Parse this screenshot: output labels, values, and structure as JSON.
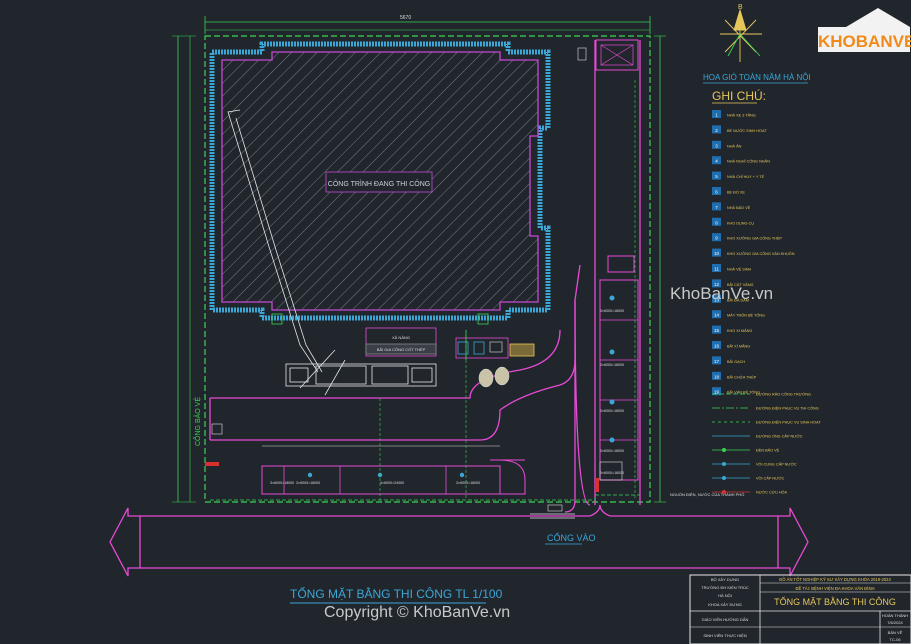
{
  "logo": {
    "text": "KHOBANVE"
  },
  "watermarks": {
    "main": "KhoBanVe.vn",
    "copyright": "Copyright © KhoBanVe.vn"
  },
  "compass": {
    "north": "B"
  },
  "legend": {
    "wind_title": "HOA GIÓ TOÀN NĂM HÀ NỘI",
    "title": "GHI CHÚ:",
    "numbered": [
      {
        "n": "1",
        "label": "NHÀ XE 3 TẦNG"
      },
      {
        "n": "2",
        "label": "BỂ NƯỚC SINH HOẠT"
      },
      {
        "n": "3",
        "label": "NHÀ ĂN"
      },
      {
        "n": "4",
        "label": "NHÀ NGHỈ CÔNG NHÂN"
      },
      {
        "n": "5",
        "label": "NHÀ CHỈ HUY + Y TẾ"
      },
      {
        "n": "6",
        "label": "BỂ ĐỔ XE"
      },
      {
        "n": "7",
        "label": "NHÀ BẢO VỆ"
      },
      {
        "n": "8",
        "label": "KHO DỤNG CỤ"
      },
      {
        "n": "9",
        "label": "KHO XƯỞNG GIA CÔNG THÉP"
      },
      {
        "n": "10",
        "label": "KHO XƯỞNG GIA CÔNG VÁN KHUÔN"
      },
      {
        "n": "11",
        "label": "NHÀ VỆ SINH"
      },
      {
        "n": "12",
        "label": "BÃI CÁT VÀNG"
      },
      {
        "n": "13",
        "label": "BÃI ĐÁ DĂM"
      },
      {
        "n": "14",
        "label": "MÁY TRỘN BÊ TÔNG"
      },
      {
        "n": "15",
        "label": "KHO XI MĂNG"
      },
      {
        "n": "16",
        "label": "BÃI XÍ MĂNG"
      },
      {
        "n": "17",
        "label": "BÃI GẠCH"
      },
      {
        "n": "18",
        "label": "BÃI CHỨA THÉP"
      },
      {
        "n": "19",
        "label": "BÃI VÁN BÊ TÔNG"
      }
    ],
    "symbols": [
      {
        "label": "ĐƯỜNG RÀO CÔNG TRƯỜNG"
      },
      {
        "label": "ĐƯỜNG ĐIỆN PHỤC VỤ THI CÔNG"
      },
      {
        "label": "ĐƯỜNG ĐIỆN PHỤC VỤ SINH HOẠT"
      },
      {
        "label": "ĐƯỜNG ỐNG CẤP NƯỚC"
      },
      {
        "label": "ĐÈN BẢO VỆ"
      },
      {
        "label": "VÒI CUNG CẤP NƯỚC"
      },
      {
        "label": "VÒI CẤP NƯỚC"
      },
      {
        "label": "NƯỚC CỨU HỎA"
      }
    ]
  },
  "site": {
    "building_label": "CÔNG TRÌNH ĐANG THI CÔNG",
    "gate_label": "CỔNG VÀO",
    "side_gate_label": "CỔNG BẢO VỆ",
    "supply_label": "NGUỒN ĐIỆN, NƯỚC CỦA THÀNH PHỐ",
    "crane_label1": "XÂ NÂNG",
    "crane_label2": "BÃI GIA CÔNG CỐT THÉP",
    "dim_top": "5670",
    "site_dims": [
      "3×6000=18000",
      "3×6000=18000",
      "4×6000=24000",
      "3×6000=18000"
    ],
    "right_dims": [
      "3×6000=18000",
      "3×6000=18000",
      "3×6000=18000",
      "3×6000=18000",
      "3×6000=18000"
    ]
  },
  "title": "TỔNG MẶT BẰNG THI CÔNG TL 1/100",
  "title_block": {
    "ministry": "BỘ XÂY DỰNG",
    "university": "TRƯỜNG ĐH KIẾN TRÚC",
    "city": "HÀ NỘI",
    "faculty": "KHOA XÂY DỰNG",
    "thesis": "ĐỒ ÁN TỐT NGHIỆP KỸ SƯ XÂY DỰNG KHÓA 2019-2024",
    "project": "ĐỀ TÀI: BỆNH VIỆN ĐA KHOA VĂN ĐÌNH",
    "drawing": "TỔNG MẶT BẰNG THI CÔNG",
    "advisor": "GIÁO VIÊN HƯỚNG DẪN",
    "student": "SINH VIÊN THỰC HIỆN",
    "date_label": "HOÀN THÀNH",
    "date": "7/6/2024",
    "sheet_label": "BẢN VẼ",
    "sheet": "TC-05"
  }
}
